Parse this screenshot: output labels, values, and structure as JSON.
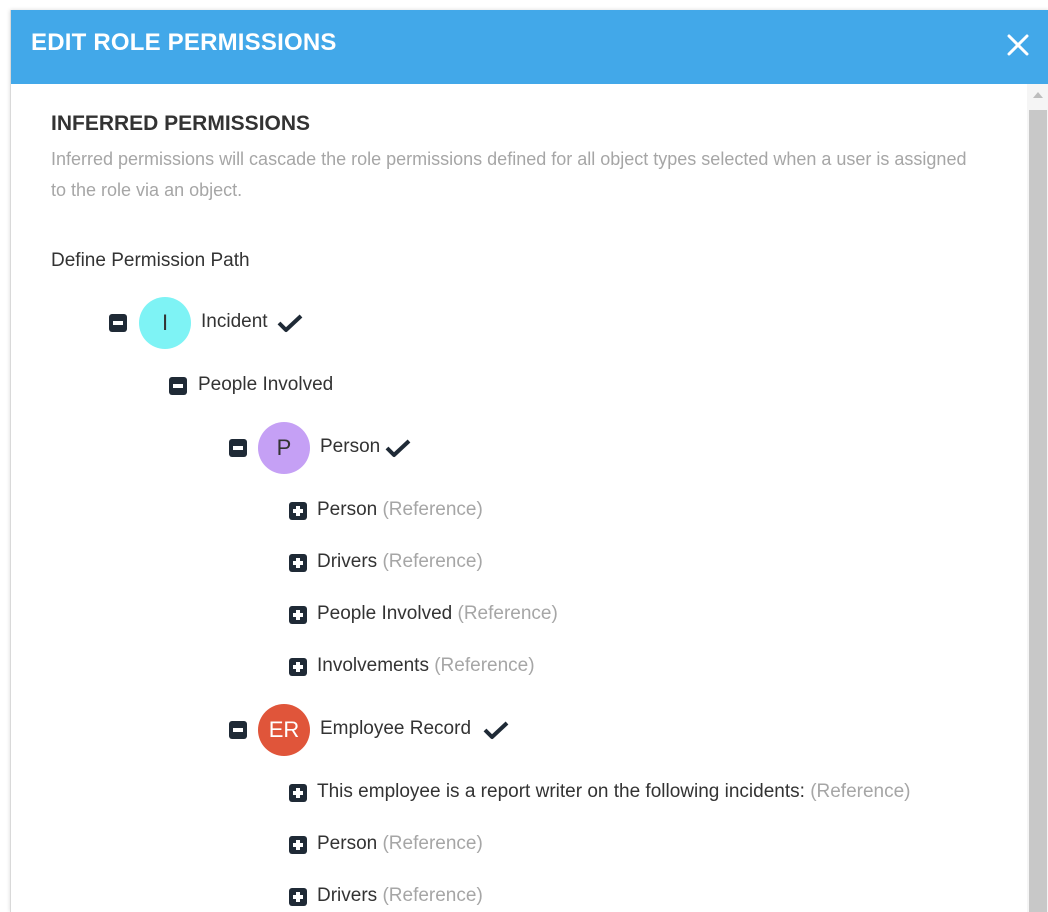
{
  "dialog": {
    "title": "EDIT ROLE PERMISSIONS",
    "close_icon": "close-icon",
    "header_color": "#42a8e9"
  },
  "inferred": {
    "title": "INFERRED PERMISSIONS",
    "description": "Inferred permissions will cascade the role permissions defined for all object types selected when a user is assigned to the role via an object."
  },
  "path": {
    "label": "Define Permission Path"
  },
  "tree": {
    "incident": {
      "avatar": "I",
      "avatar_color": "#7ef3f5",
      "label": "Incident",
      "checked": true,
      "toggle": "minus"
    },
    "people_involved": {
      "label": "People Involved",
      "toggle": "minus"
    },
    "person": {
      "avatar": "P",
      "avatar_color": "#c5a0f5",
      "label": "Person",
      "checked": true,
      "toggle": "minus"
    },
    "person_children": [
      {
        "label": "Person",
        "ref": "(Reference)"
      },
      {
        "label": "Drivers",
        "ref": "(Reference)"
      },
      {
        "label": "People Involved",
        "ref": "(Reference)"
      },
      {
        "label": "Involvements",
        "ref": "(Reference)"
      }
    ],
    "employee": {
      "avatar": "ER",
      "avatar_color": "#e0553a",
      "label": "Employee Record",
      "checked": true,
      "toggle": "minus"
    },
    "employee_children": [
      {
        "label": "This employee is a report writer on the following incidents:",
        "ref": "(Reference)"
      },
      {
        "label": "Person",
        "ref": "(Reference)"
      },
      {
        "label": "Drivers",
        "ref": "(Reference)"
      }
    ]
  }
}
